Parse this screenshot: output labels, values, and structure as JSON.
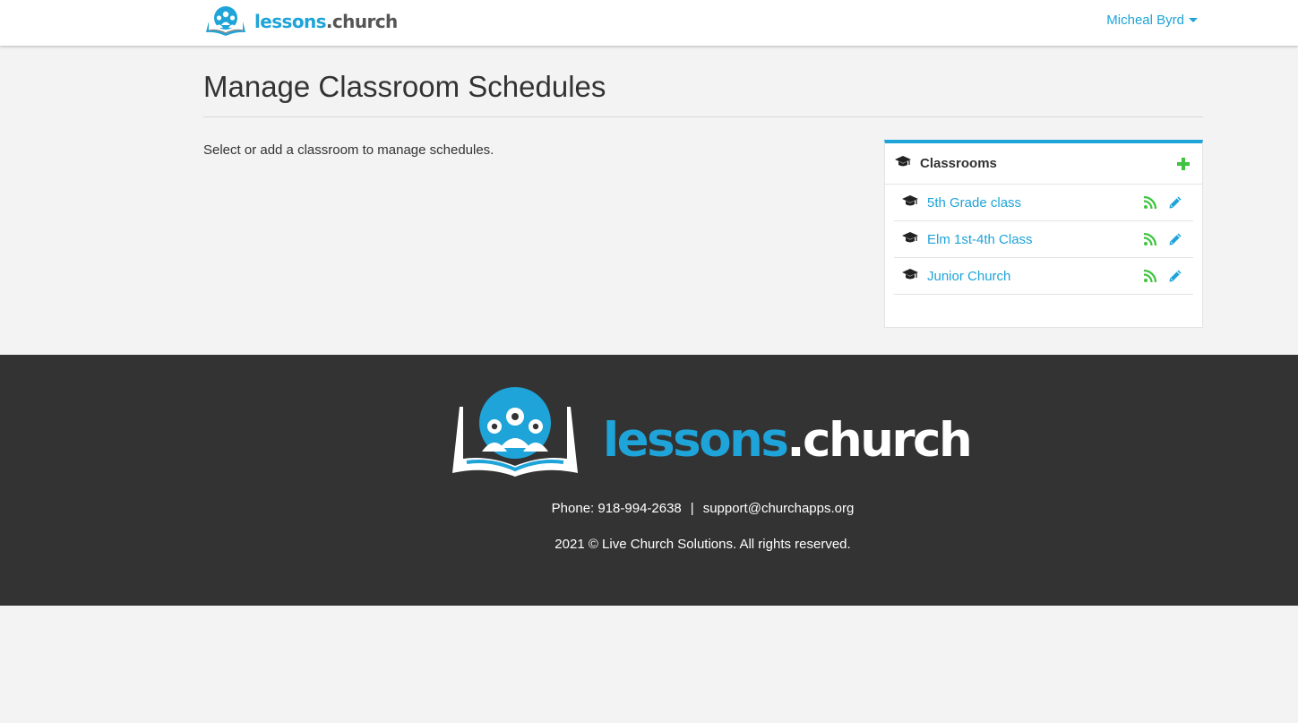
{
  "header": {
    "brand_main": "lessons",
    "brand_suffix": ".church",
    "user_name": "Micheal Byrd"
  },
  "main": {
    "title": "Manage Classroom Schedules",
    "intro": "Select or add a classroom to manage schedules."
  },
  "panel": {
    "title": "Classrooms",
    "classrooms": [
      {
        "name": "5th Grade class"
      },
      {
        "name": "Elm 1st-4th Class"
      },
      {
        "name": "Junior Church"
      }
    ]
  },
  "footer": {
    "brand_main": "lessons",
    "brand_suffix": ".church",
    "phone": "Phone: 918-994-2638",
    "separator": "|",
    "email": "support@churchapps.org",
    "copyright": "2021 © Live Church Solutions. All rights reserved."
  },
  "colors": {
    "accent": "#1ea4d8",
    "add": "#3ec43e",
    "rss": "#3ec43e",
    "footer_bg": "#333333"
  },
  "icons": {
    "brand": "lessons-church-logo-icon",
    "classroom": "graduation-cap-icon",
    "add": "plus-icon",
    "feed": "rss-icon",
    "edit": "pencil-icon"
  }
}
